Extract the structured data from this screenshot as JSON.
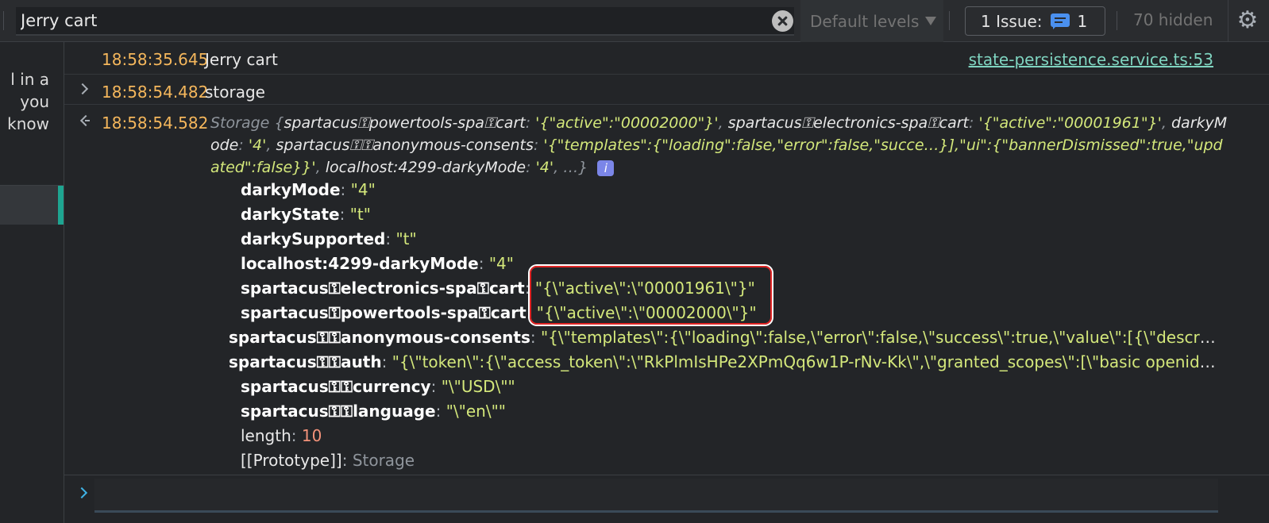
{
  "toolbar": {
    "filter_value": "Jerry cart",
    "levels_label": "Default levels",
    "issues_label": "1 Issue:",
    "issues_count": "1",
    "hidden_count": "70 hidden"
  },
  "sidebar": {
    "lines": [
      "l in a",
      "you",
      " know"
    ]
  },
  "console": {
    "messages": [
      {
        "timestamp": "18:58:35.645",
        "text": "Jerry cart",
        "source": "state-persistence.service.ts:53"
      },
      {
        "timestamp": "18:58:54.482",
        "text": "storage"
      },
      {
        "timestamp": "18:58:54.582"
      }
    ],
    "preview": {
      "class_name": "Storage",
      "open_brace": "{",
      "close": ", …}",
      "entries": [
        {
          "key": "spartacus⚿powertools-spa⚿cart",
          "value": "'{\"active\":\"00002000\"}'"
        },
        {
          "key": "spartacus⚿electronics-spa⚿cart",
          "value": "'{\"active\":\"00001961\"}'"
        },
        {
          "key": "darkyMode",
          "value": "'4'"
        },
        {
          "key": "spartacus⚿⚿anonymous-consents",
          "value": "'{\"templates\":{\"loading\":false,\"error\":false,\"succe…}],\"ui\":{\"bannerDismissed\":true,\"updated\":false}}'"
        },
        {
          "key": "localhost:4299-darkyMode",
          "value": "'4'"
        }
      ]
    },
    "props": [
      {
        "key": "darkyMode",
        "value": "\"4\""
      },
      {
        "key": "darkyState",
        "value": "\"t\""
      },
      {
        "key": "darkySupported",
        "value": "\"t\""
      },
      {
        "key": "localhost:4299-darkyMode",
        "value": "\"4\""
      },
      {
        "key": "spartacus⚿electronics-spa⚿cart",
        "value": "\"{\\\"active\\\":\\\"00001961\\\"}\""
      },
      {
        "key": "spartacus⚿powertools-spa⚿cart",
        "value": "\"{\\\"active\\\":\\\"00002000\\\"}\""
      },
      {
        "key": "spartacus⚿⚿anonymous-consents",
        "value": "\"{\\\"templates\\\":{\\\"loading\\\":false,\\\"error\\\":false,\\\"success\\\":true,\\\"value\\\":[{\\\"descript…"
      },
      {
        "key": "spartacus⚿⚿auth",
        "value": "\"{\\\"token\\\":{\\\"access_token\\\":\\\"RkPlmIsHPe2XPmQq6w1P-rNv-Kk\\\",\\\"granted_scopes\\\":[\\\"basic openid\\\"…"
      },
      {
        "key": "spartacus⚿⚿currency",
        "value": "\"\\\"USD\\\"\""
      },
      {
        "key": "spartacus⚿⚿language",
        "value": "\"\\\"en\\\"\""
      },
      {
        "key": "length",
        "value": "10"
      },
      {
        "key": "[[Prototype]]",
        "value": "Storage"
      }
    ]
  },
  "icons": {
    "clear": "clear-icon",
    "levels_caret": "caret-down-icon",
    "issue": "message-icon",
    "settings": "gear-icon",
    "expand": "chevron-right-icon",
    "result": "return-arrow-icon",
    "info": "info-icon"
  },
  "colors": {
    "timestamp": "#f5b75c",
    "string": "#d4e87b",
    "number": "#f4937a",
    "link": "#7fd4c0",
    "accent": "#1ea591",
    "highlight_box": "#e02424"
  }
}
